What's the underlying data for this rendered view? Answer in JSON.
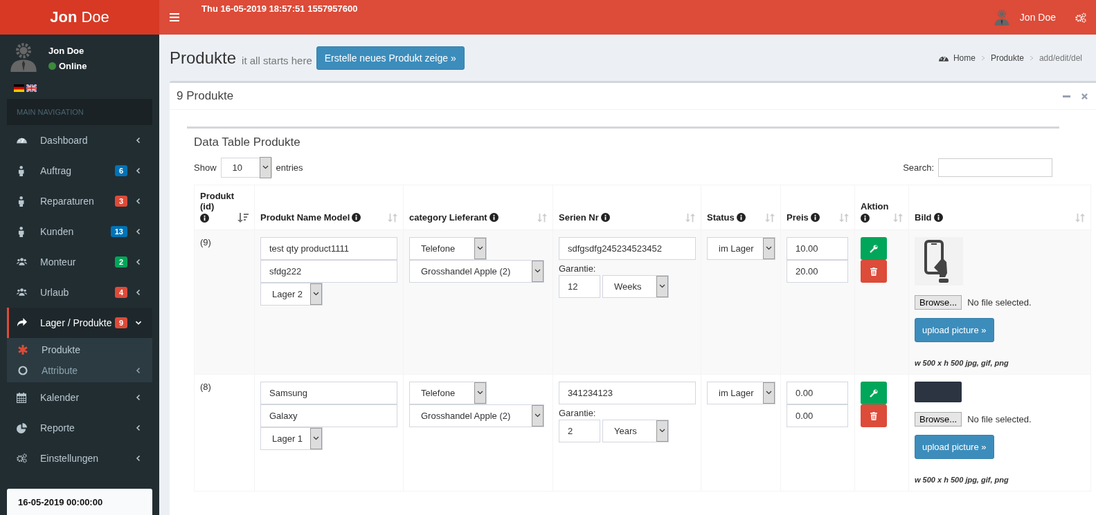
{
  "brand": {
    "first": "Jon",
    "second": "Doe"
  },
  "header": {
    "datetime": "Thu 16-05-2019 18:57:51 1557957600",
    "user": "Jon Doe"
  },
  "sidebar": {
    "user": {
      "name": "Jon Doe",
      "status": "Online"
    },
    "section": "MAIN NAVIGATION",
    "items": [
      {
        "label": "Dashboard",
        "expanded": false,
        "selected": false
      },
      {
        "label": "Auftrag",
        "badge": "6",
        "color": "#0073b7",
        "expanded": false,
        "selected": false
      },
      {
        "label": "Reparaturen",
        "badge": "3",
        "color": "#dd4b39",
        "expanded": false,
        "selected": false
      },
      {
        "label": "Kunden",
        "badge": "13",
        "color": "#0073b7",
        "expanded": false,
        "selected": false
      },
      {
        "label": "Monteur",
        "badge": "2",
        "color": "#00a65a",
        "expanded": false,
        "selected": false
      },
      {
        "label": "Urlaub",
        "badge": "4",
        "color": "#dd4b39",
        "expanded": false,
        "selected": false
      },
      {
        "label": "Lager / Produkte",
        "badge": "9",
        "color": "#dd4b39",
        "expanded": true,
        "selected": true,
        "children": [
          {
            "label": "Produkte",
            "selected": true,
            "expandable": false
          },
          {
            "label": "Attribute",
            "selected": false,
            "expandable": true
          }
        ]
      },
      {
        "label": "Kalender",
        "expanded": false,
        "selected": false
      },
      {
        "label": "Reporte",
        "expanded": false,
        "selected": false
      },
      {
        "label": "Einstellungen",
        "expanded": false,
        "selected": false
      }
    ],
    "footer_date": "16-05-2019 00:00:00"
  },
  "page": {
    "title": "Produkte",
    "subtitle": "it all starts here",
    "create_button": "Erstelle neues Produkt zeige »",
    "breadcrumb": [
      {
        "label": "Home",
        "selected": false
      },
      {
        "label": "Produkte",
        "selected": false
      },
      {
        "label": "add/edit/del",
        "selected": true
      }
    ]
  },
  "box": {
    "title": "9 Produkte"
  },
  "table": {
    "title": "Data Table Produkte",
    "show_label": "Show",
    "page_size": "10",
    "entries_label": "entries",
    "search_label": "Search:",
    "columns": [
      {
        "label": "Produkt (id)",
        "sorted": true
      },
      {
        "label": "Produkt Name Model",
        "sorted": false
      },
      {
        "label": "category Lieferant",
        "sorted": false
      },
      {
        "label": "Serien Nr",
        "sorted": false
      },
      {
        "label": "Status",
        "sorted": false
      },
      {
        "label": "Preis",
        "sorted": false
      },
      {
        "label": "Aktion",
        "sorted": false
      },
      {
        "label": "Bild",
        "sorted": false
      }
    ],
    "rows": [
      {
        "id": "(9)",
        "name": "test qty product1111",
        "model": "sfdg222",
        "storage": "Lager 2",
        "category": "Telefone",
        "supplier": "Grosshandel Apple (2)",
        "serial": "sdfgsdfg245234523452",
        "warranty_label": "Garantie:",
        "warranty_value": "12",
        "warranty_unit": "Weeks",
        "status": "im Lager",
        "price_1": "10.00",
        "price_2": "20.00",
        "kind": "icon",
        "browse": "Browse...",
        "file_status": "No file selected.",
        "upload": "upload picture »",
        "hint": "w 500 x h 500 jpg, gif, png"
      },
      {
        "id": "(8)",
        "name": "Samsung",
        "model": "Galaxy",
        "storage": "Lager 1",
        "category": "Telefone",
        "supplier": "Grosshandel Apple (2)",
        "serial": "341234123",
        "warranty_label": "Garantie:",
        "warranty_value": "2",
        "warranty_unit": "Years",
        "status": "im Lager",
        "price_1": "0.00",
        "price_2": "0.00",
        "kind": "photo",
        "browse": "Browse...",
        "file_status": "No file selected.",
        "upload": "upload picture »",
        "hint": "w 500 x h 500 jpg, gif, png"
      }
    ]
  }
}
